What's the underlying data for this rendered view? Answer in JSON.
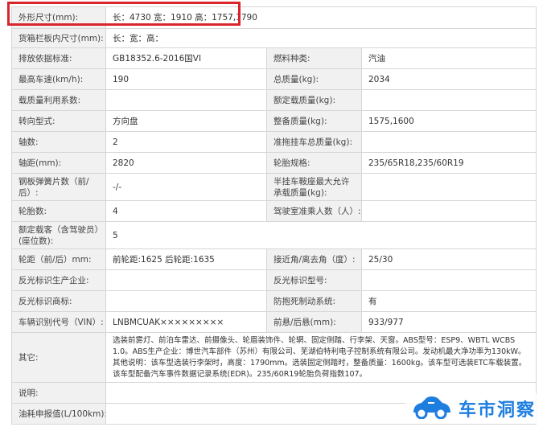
{
  "rows": {
    "r1": {
      "l1": "外形尺寸(mm):",
      "v1": "长：4730 宽：1910 高：1757,1790"
    },
    "r2": {
      "l1": "货箱栏板内尺寸(mm):",
      "v1": "长：宽：高："
    },
    "r3": {
      "l1": "排放依据标准:",
      "v1": "GB18352.6-2016国VI",
      "l2": "燃料种类:",
      "v2": "汽油"
    },
    "r4": {
      "l1": "最高车速(km/h):",
      "v1": "190",
      "l2": "总质量(kg):",
      "v2": "2034"
    },
    "r5": {
      "l1": "载质量利用系数:",
      "v1": "",
      "l2": "额定载质量(kg):",
      "v2": ""
    },
    "r6": {
      "l1": "转向型式:",
      "v1": "方向盘",
      "l2": "整备质量(kg):",
      "v2": "1575,1600"
    },
    "r7": {
      "l1": "轴数:",
      "v1": "2",
      "l2": "准拖挂车总质量(kg):",
      "v2": ""
    },
    "r8": {
      "l1": "轴距(mm):",
      "v1": "2820",
      "l2": "轮胎规格:",
      "v2": "235/65R18,235/60R19"
    },
    "r9": {
      "l1": "钢板弹簧片数（前/后）:",
      "v1": "-/-",
      "l2": "半挂车鞍座最大允许承载质量(kg):",
      "v2": ""
    },
    "r10": {
      "l1": "轮胎数:",
      "v1": "4",
      "l2": "驾驶室准乘人数（人）:",
      "v2": ""
    },
    "r11": {
      "l1": "额定载客（含驾驶员）(座位数):",
      "v1": "5"
    },
    "r12": {
      "l1": "轮距（前/后）mm:",
      "v1": "前轮距:1625 后轮距:1635",
      "l2": "接近角/离去角（度）:",
      "v2": "25/30"
    },
    "r13": {
      "l1": "反光标识生产企业:",
      "v1": "",
      "l2": "反光标识型号:",
      "v2": ""
    },
    "r14": {
      "l1": "反光标识商标:",
      "v1": "",
      "l2": "防抱死制动系统:",
      "v2": "有"
    },
    "r15": {
      "l1": "车辆识别代号（VIN）:",
      "v1": "LNBMCUAK×××××××××",
      "l2": "前悬/后悬(mm):",
      "v2": "933/977"
    },
    "r16": {
      "l1": "其它:",
      "v1": "选装前雾灯、前泊车雷达、前摄像头、轮眉装饰件、轮辋、固定侧踏、行李架、天窗。ABS型号：ESP9、WBTL WCBS 1.0。ABS生产企业：博世汽车部件（苏州）有限公司、芜湖伯特利电子控制系统有限公司。发动机最大净功率为130kW。其他说明：该车型选装行李架时，高度：1790mm。选装固定侧踏时，整备质量：1600kg。该车型可选装ETC车载装置。该车型配备汽车事件数据记录系统(EDR)。235/60R19轮胎负荷指数107。"
    },
    "r17": {
      "l1": "说明:",
      "v1": ""
    },
    "r18": {
      "l1": "油耗申报值(L/100km):",
      "v1": ""
    }
  },
  "watermark": {
    "text": "车市洞察",
    "icon": "car-logo-icon",
    "color": "#1e7ee0"
  },
  "highlight_color": "#d9252b"
}
